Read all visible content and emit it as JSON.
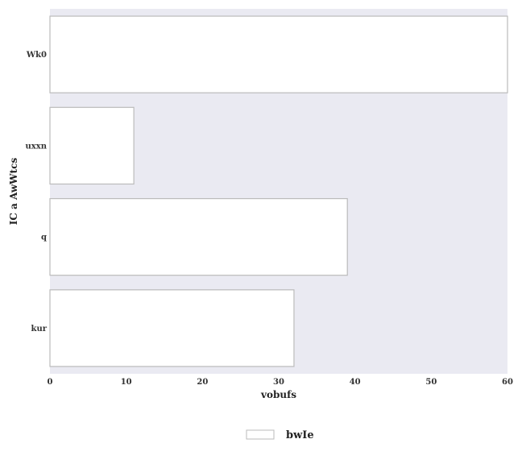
{
  "chart_data": {
    "type": "bar",
    "orientation": "horizontal",
    "categories": [
      "Wk0",
      "uxxn",
      "q",
      "kur"
    ],
    "series": [
      {
        "name": "bwIe",
        "values": [
          60,
          11,
          39,
          32
        ]
      }
    ],
    "xlabel": "vobufs",
    "ylabel": "IC a AwWtcs",
    "xlim": [
      0,
      60
    ],
    "xticks": [
      0,
      10,
      20,
      30,
      40,
      50,
      60
    ],
    "grid": false,
    "legend_position": "bottom-center",
    "colors": {
      "plot_background": "#eaeaf2",
      "bar_fill": "#ffffff",
      "bar_stroke": "#bbbbbb"
    }
  }
}
